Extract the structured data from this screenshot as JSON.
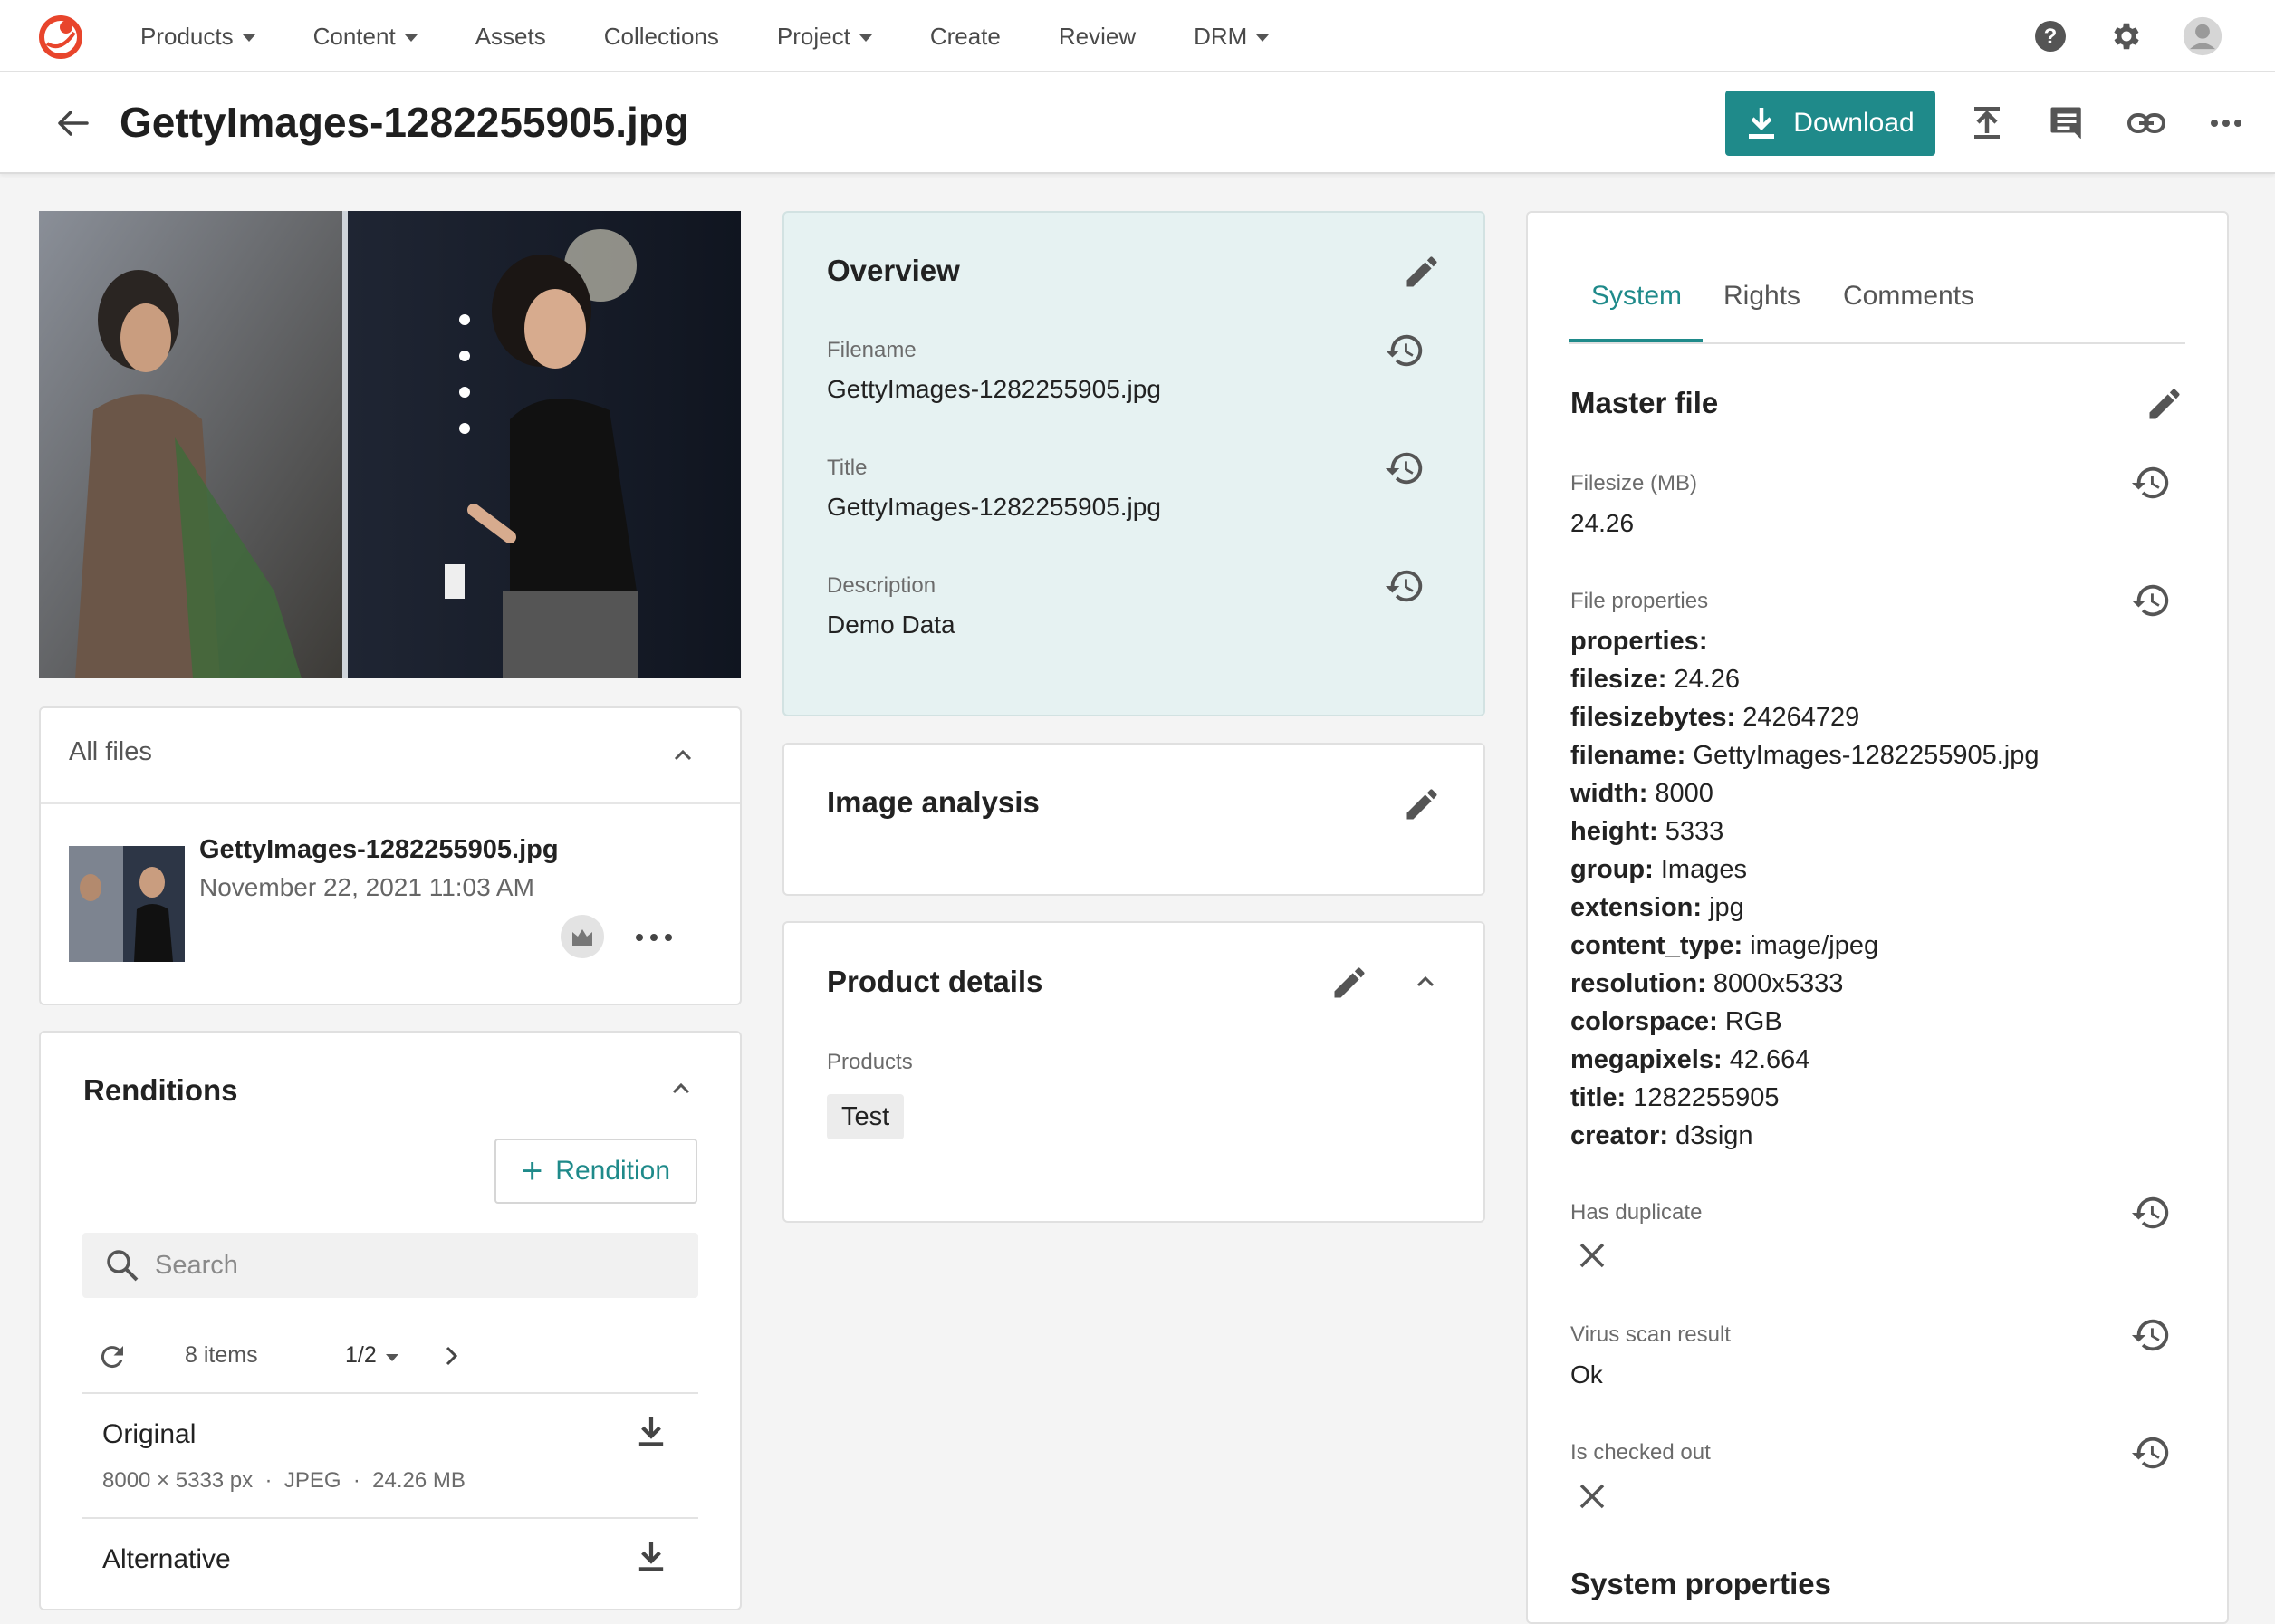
{
  "nav": {
    "items": [
      {
        "label": "Products",
        "dropdown": true
      },
      {
        "label": "Content",
        "dropdown": true
      },
      {
        "label": "Assets",
        "dropdown": false
      },
      {
        "label": "Collections",
        "dropdown": false
      },
      {
        "label": "Project",
        "dropdown": true
      },
      {
        "label": "Create",
        "dropdown": false
      },
      {
        "label": "Review",
        "dropdown": false
      },
      {
        "label": "DRM",
        "dropdown": true
      }
    ],
    "icons": [
      "help-icon",
      "gear-icon",
      "avatar-icon"
    ]
  },
  "header": {
    "title": "GettyImages-1282255905.jpg",
    "download_label": "Download",
    "icons": [
      "upload-icon",
      "comment-icon",
      "link-icon",
      "more-icon"
    ]
  },
  "files": {
    "title": "All files",
    "item": {
      "name": "GettyImages-1282255905.jpg",
      "date": "November 22, 2021 11:03 AM"
    }
  },
  "renditions": {
    "title": "Renditions",
    "add_label": "Rendition",
    "search_placeholder": "Search",
    "count": "8 items",
    "page": "1/2",
    "rows": [
      {
        "name": "Original",
        "meta": "8000 × 5333 px  ·  JPEG  ·  24.26 MB"
      },
      {
        "name": "Alternative",
        "meta": ""
      }
    ]
  },
  "overview": {
    "title": "Overview",
    "fields": [
      {
        "label": "Filename",
        "value": "GettyImages-1282255905.jpg"
      },
      {
        "label": "Title",
        "value": "GettyImages-1282255905.jpg"
      },
      {
        "label": "Description",
        "value": "Demo Data"
      }
    ]
  },
  "image_analysis": {
    "title": "Image analysis"
  },
  "product_details": {
    "title": "Product details",
    "products_label": "Products",
    "tag": "Test"
  },
  "right": {
    "tabs": [
      "System",
      "Rights",
      "Comments"
    ],
    "active_tab": "System",
    "section_title": "Master file",
    "filesize_label": "Filesize (MB)",
    "filesize_value": "24.26",
    "file_properties_label": "File properties",
    "properties": [
      {
        "k": "properties:",
        "v": ""
      },
      {
        "k": "filesize:",
        "v": "24.26"
      },
      {
        "k": "filesizebytes:",
        "v": "24264729"
      },
      {
        "k": "filename:",
        "v": "GettyImages-1282255905.jpg"
      },
      {
        "k": "width:",
        "v": "8000"
      },
      {
        "k": "height:",
        "v": "5333"
      },
      {
        "k": "group:",
        "v": "Images"
      },
      {
        "k": "extension:",
        "v": "jpg"
      },
      {
        "k": "content_type:",
        "v": "image/jpeg"
      },
      {
        "k": "resolution:",
        "v": "8000x5333"
      },
      {
        "k": "colorspace:",
        "v": "RGB"
      },
      {
        "k": "megapixels:",
        "v": "42.664"
      },
      {
        "k": "title:",
        "v": "1282255905"
      },
      {
        "k": "creator:",
        "v": "d3sign"
      }
    ],
    "has_duplicate_label": "Has duplicate",
    "virus_scan_label": "Virus scan result",
    "virus_scan_value": "Ok",
    "checked_out_label": "Is checked out",
    "next_section_title": "System properties"
  },
  "colors": {
    "accent": "#1f8a8a",
    "overview_bg": "#e6f2f2",
    "brand": "#e8452c"
  }
}
